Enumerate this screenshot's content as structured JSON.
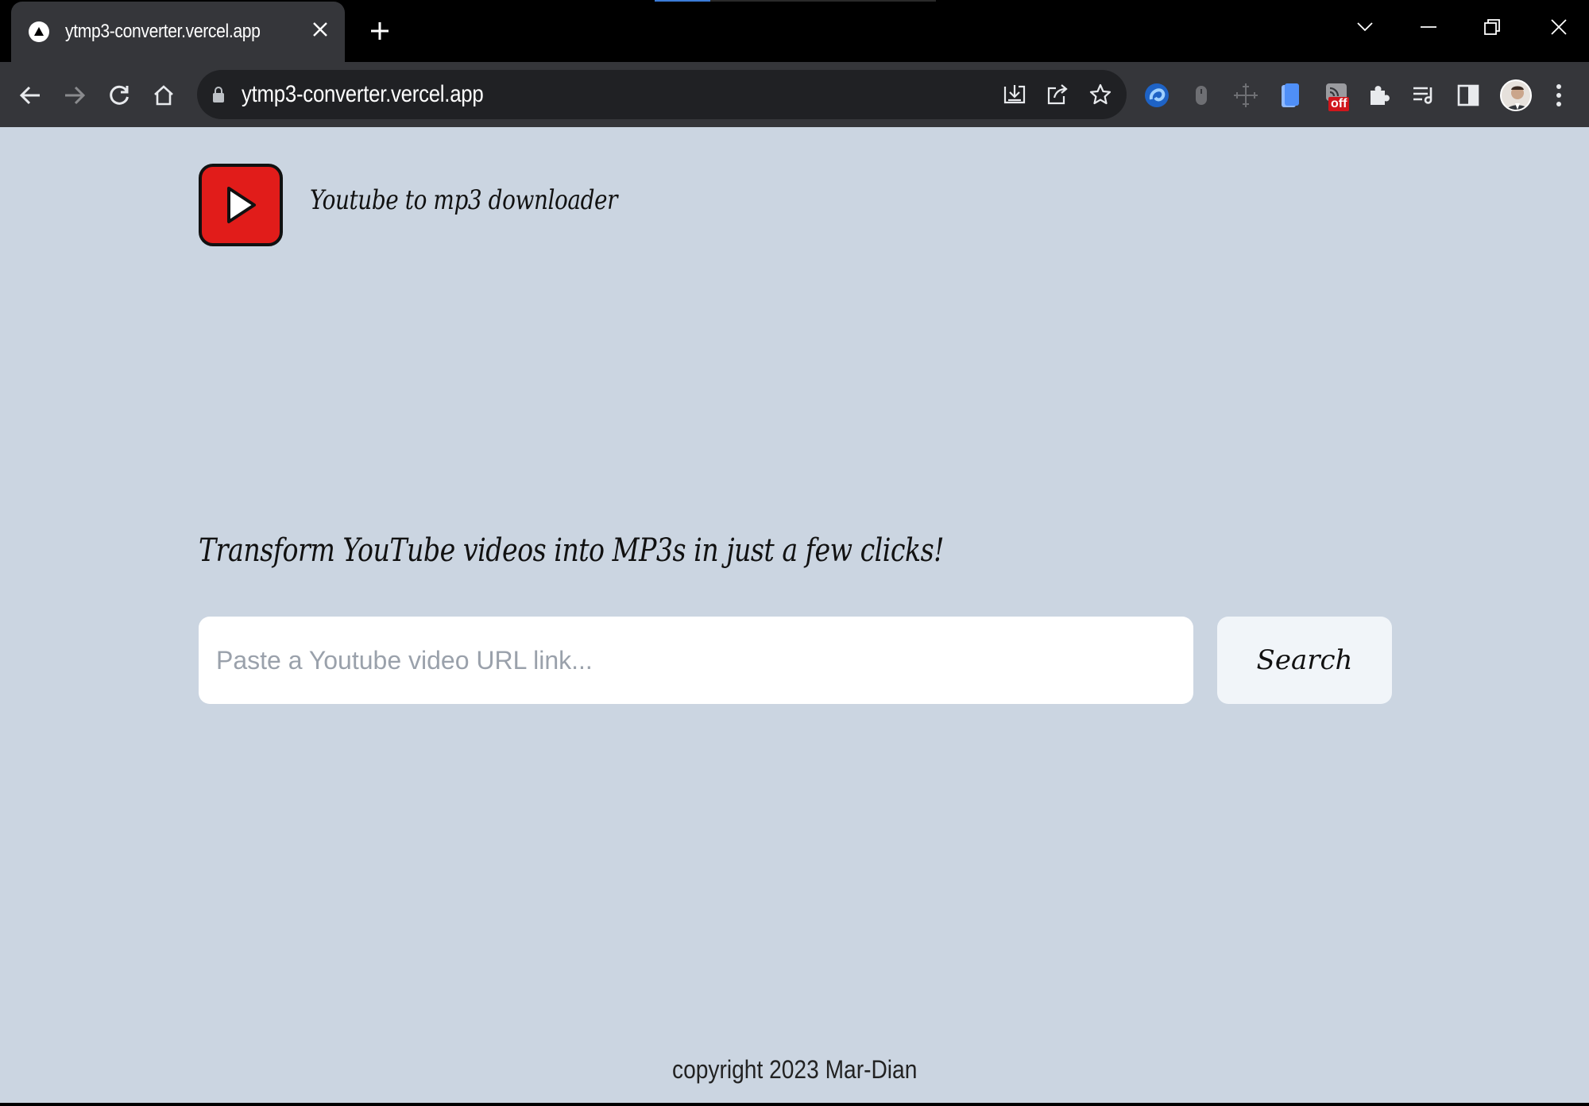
{
  "browser": {
    "tab_title": "ytmp3-converter.vercel.app",
    "url": "ytmp3-converter.vercel.app",
    "extension_badge": "off"
  },
  "header": {
    "brand_title": "Youtube to mp3 downloader"
  },
  "main": {
    "tagline": "Transform YouTube videos into MP3s in just a few clicks!",
    "search_placeholder": "Paste a Youtube video URL link...",
    "search_value": "",
    "search_button_label": "Search"
  },
  "footer": {
    "copyright": "copyright 2023 Mar-Dian"
  },
  "colors": {
    "page_background": "#cbd5e1",
    "logo_red": "#e11c1a",
    "button_background": "#f1f5f9",
    "chrome_dark": "#35363a"
  }
}
